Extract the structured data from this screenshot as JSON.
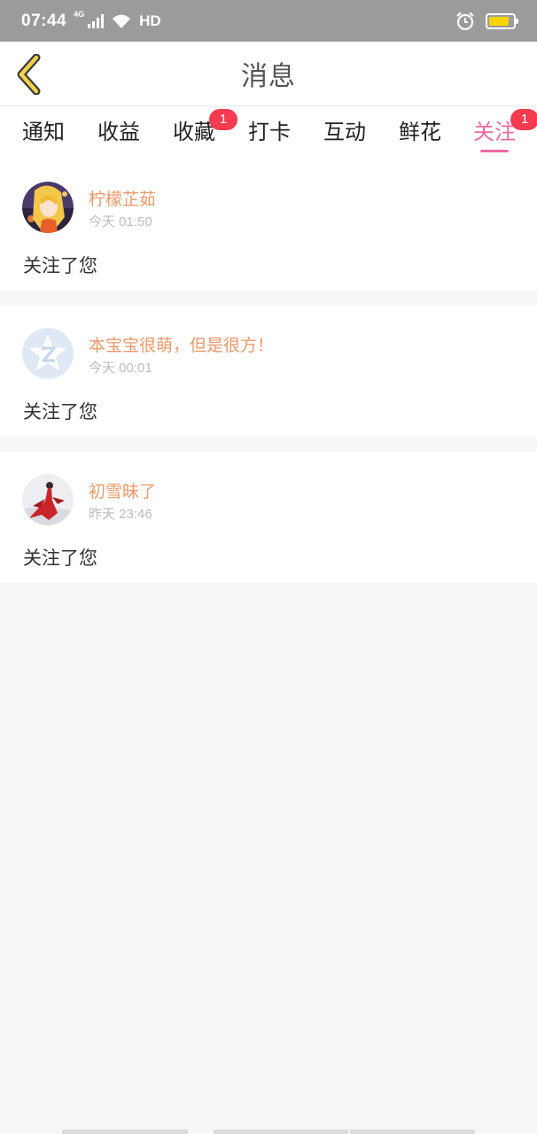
{
  "status_bar": {
    "time": "07:44",
    "network": "4G",
    "hd": "HD",
    "battery_level": 0.85,
    "icons": [
      "signal-icon",
      "wifi-icon",
      "alarm-icon",
      "battery-icon"
    ]
  },
  "header": {
    "title": "消息",
    "back_icon": "chevron-left-icon"
  },
  "tabs": [
    {
      "label": "通知",
      "badge": ""
    },
    {
      "label": "收益",
      "badge": ""
    },
    {
      "label": "收藏",
      "badge": "1"
    },
    {
      "label": "打卡",
      "badge": ""
    },
    {
      "label": "互动",
      "badge": ""
    },
    {
      "label": "鲜花",
      "badge": ""
    },
    {
      "label": "关注",
      "badge": "1",
      "active": true
    }
  ],
  "messages": [
    {
      "user": "柠檬芷茹",
      "time": "今天 01:50",
      "text": "关注了您",
      "avatar": "anime-avatar"
    },
    {
      "user": "本宝宝很萌，但是很方！",
      "time": "今天 00:01",
      "text": "关注了您",
      "avatar": "default-avatar"
    },
    {
      "user": "初雪昧了",
      "time": "昨天 23:46",
      "text": "关注了您",
      "avatar": "red-dress-avatar"
    }
  ],
  "colors": {
    "accent": "#ec6aa0",
    "username": "#ea9a6e",
    "badge": "#f43b4f",
    "status_bar": "#9b9b9b",
    "back_icon": "#f0d24a"
  }
}
